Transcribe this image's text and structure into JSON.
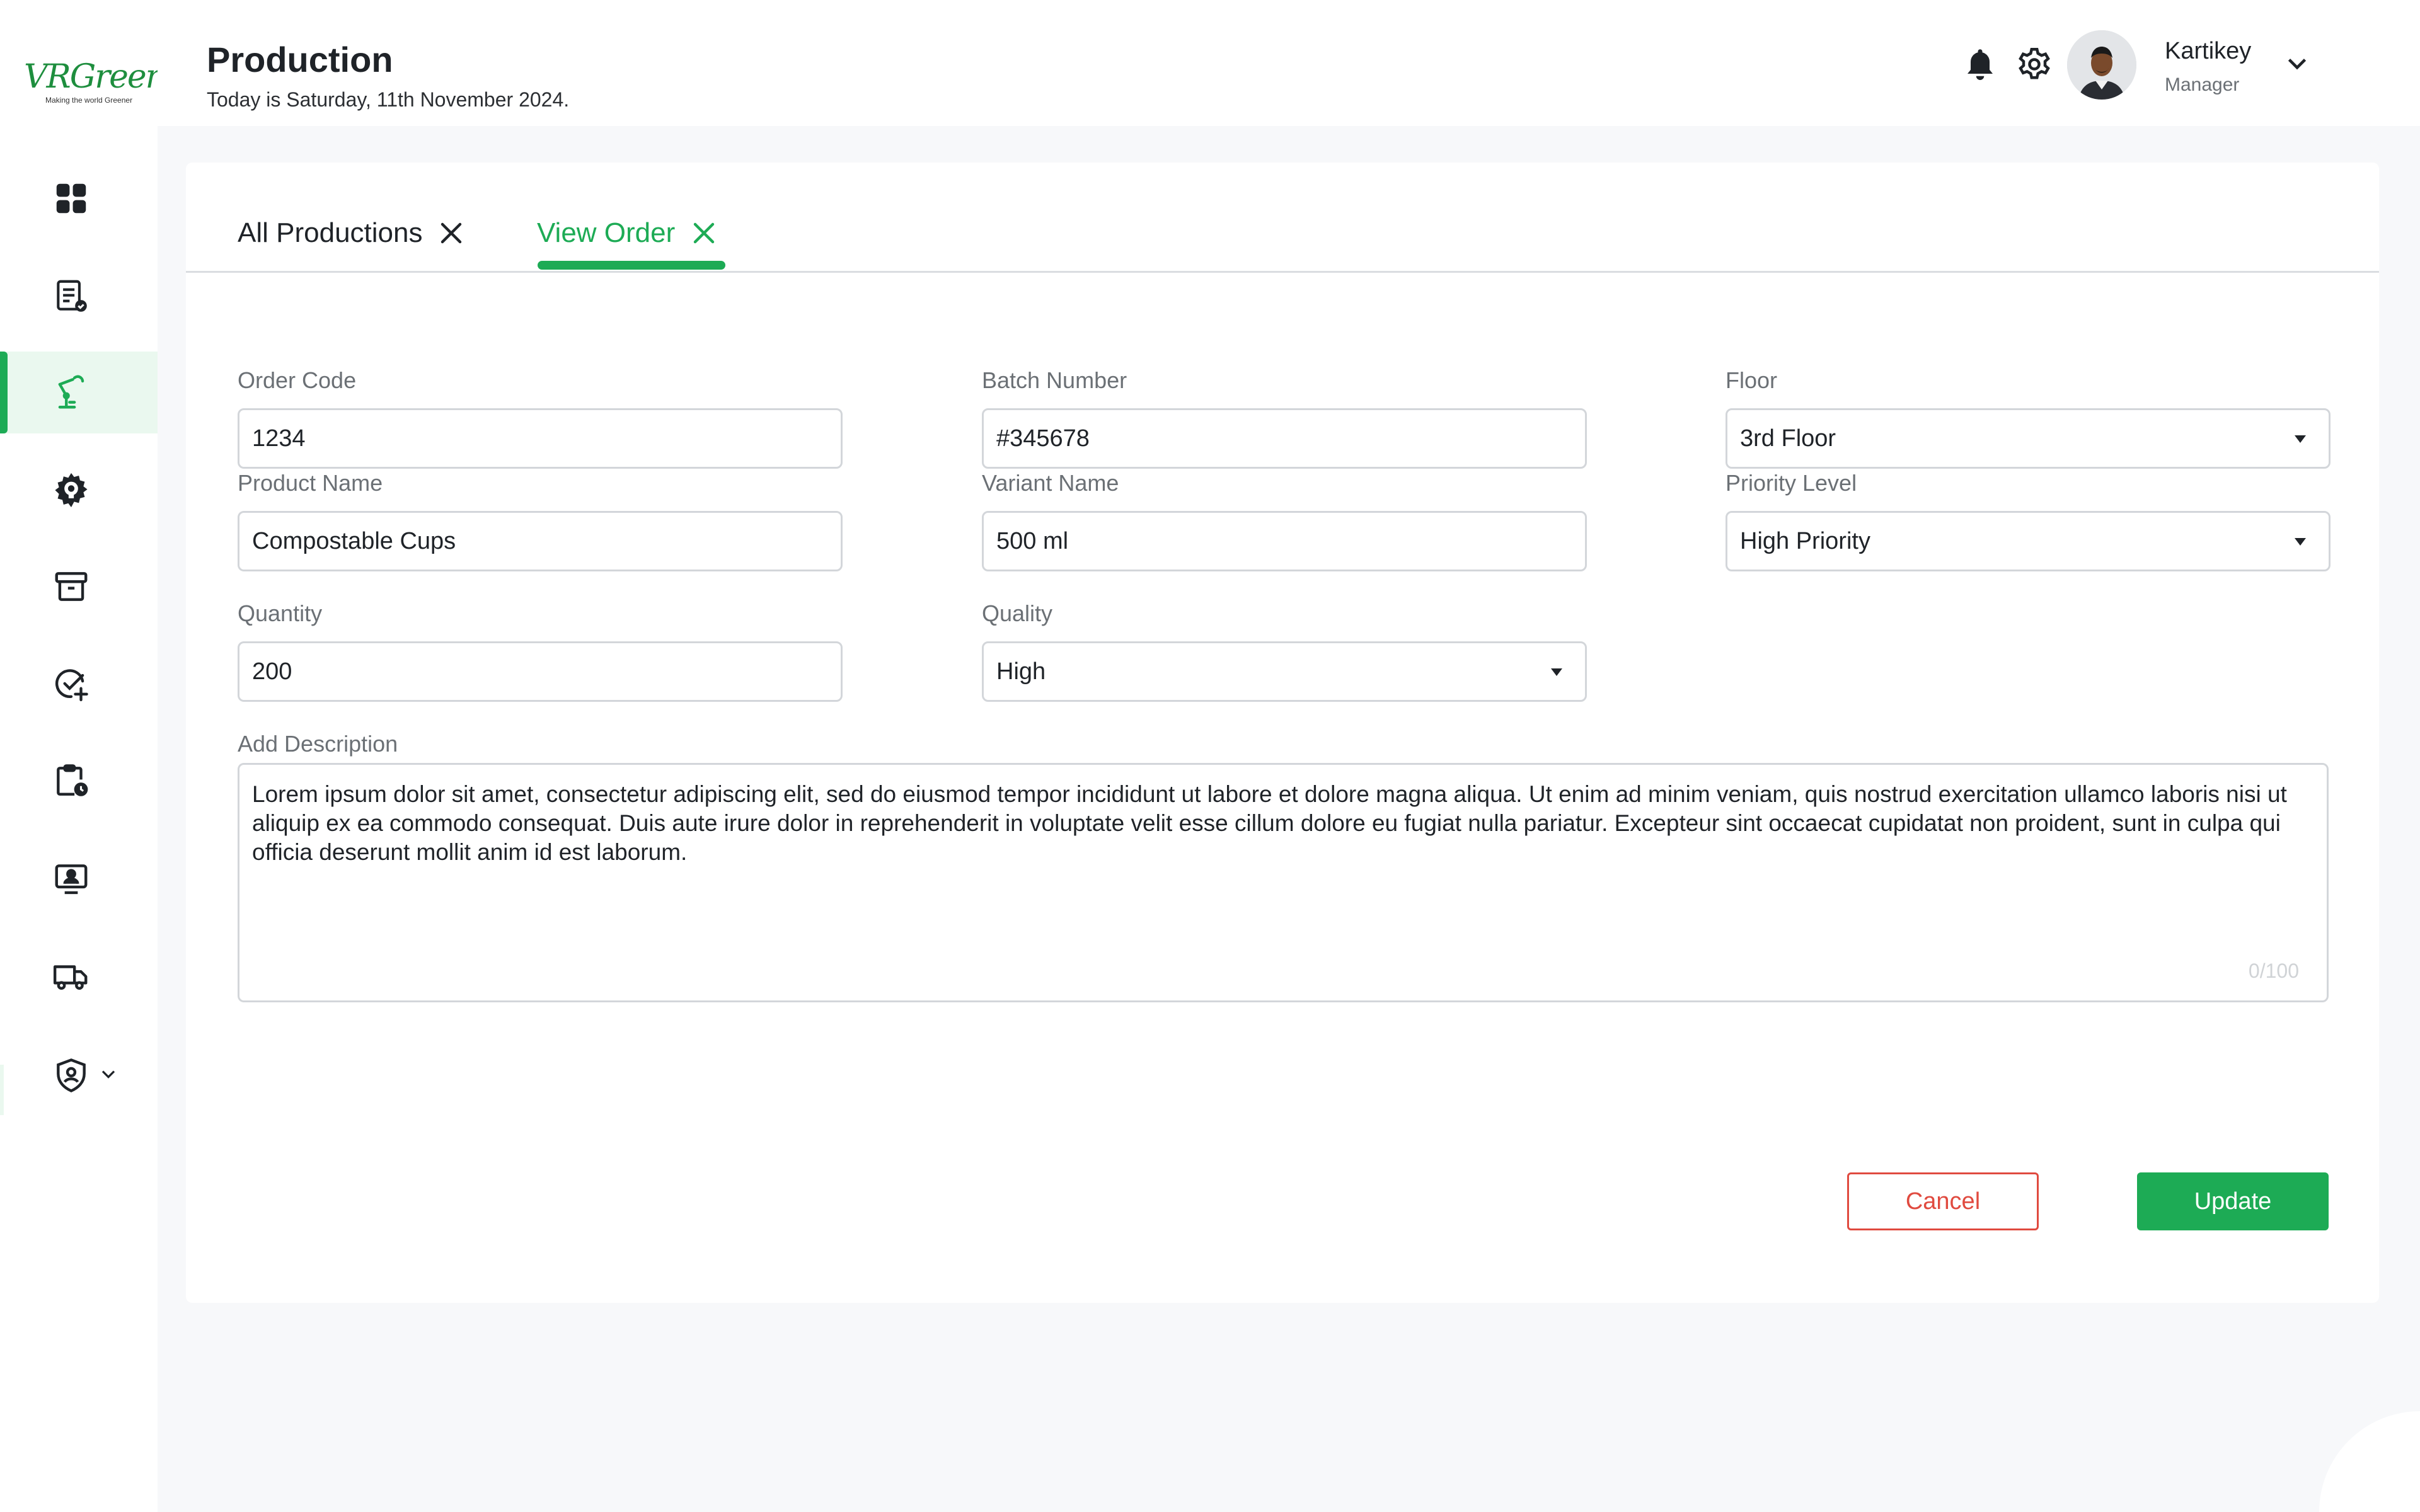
{
  "brand": {
    "logo_text": "VRGreen",
    "tagline": "Making the world Greener",
    "accent": "#1DAB55"
  },
  "sidebar": {
    "items": [
      {
        "name": "dashboard-icon"
      },
      {
        "name": "orders-icon"
      },
      {
        "name": "production-icon",
        "active": true
      },
      {
        "name": "settings-bulb-icon"
      },
      {
        "name": "archive-icon"
      },
      {
        "name": "quality-check-icon"
      },
      {
        "name": "clipboard-clock-icon"
      },
      {
        "name": "employee-icon"
      },
      {
        "name": "truck-icon"
      },
      {
        "name": "shield-user-icon"
      }
    ]
  },
  "header": {
    "title": "Production",
    "date_text": "Today is Saturday, 11th November 2024.",
    "user": {
      "name": "Kartikey",
      "role": "Manager"
    }
  },
  "tabs": [
    {
      "label": "All Productions",
      "active": false
    },
    {
      "label": "View Order",
      "active": true
    }
  ],
  "form": {
    "order_code": {
      "label": "Order Code",
      "value": "1234"
    },
    "batch_number": {
      "label": "Batch Number",
      "value": "#345678"
    },
    "floor": {
      "label": "Floor",
      "value": "3rd Floor"
    },
    "product_name": {
      "label": "Product Name",
      "value": "Compostable Cups"
    },
    "variant_name": {
      "label": "Variant Name",
      "value": "500 ml"
    },
    "priority_level": {
      "label": "Priority Level",
      "value": "High Priority"
    },
    "quantity": {
      "label": "Quantity",
      "value": "200"
    },
    "quality": {
      "label": "Quality",
      "value": "High"
    },
    "description": {
      "label": "Add Description",
      "value": "Lorem ipsum dolor sit amet, consectetur adipiscing elit, sed do eiusmod tempor incididunt ut labore et dolore magna aliqua. Ut enim ad minim veniam, quis nostrud exercitation ullamco laboris nisi ut aliquip ex ea commodo consequat. Duis aute irure dolor in reprehenderit in voluptate velit esse cillum dolore eu fugiat nulla pariatur. Excepteur sint occaecat cupidatat non proident, sunt in culpa qui officia deserunt mollit anim id est laborum.",
      "counter": "0/100"
    }
  },
  "actions": {
    "cancel_label": "Cancel",
    "update_label": "Update"
  }
}
